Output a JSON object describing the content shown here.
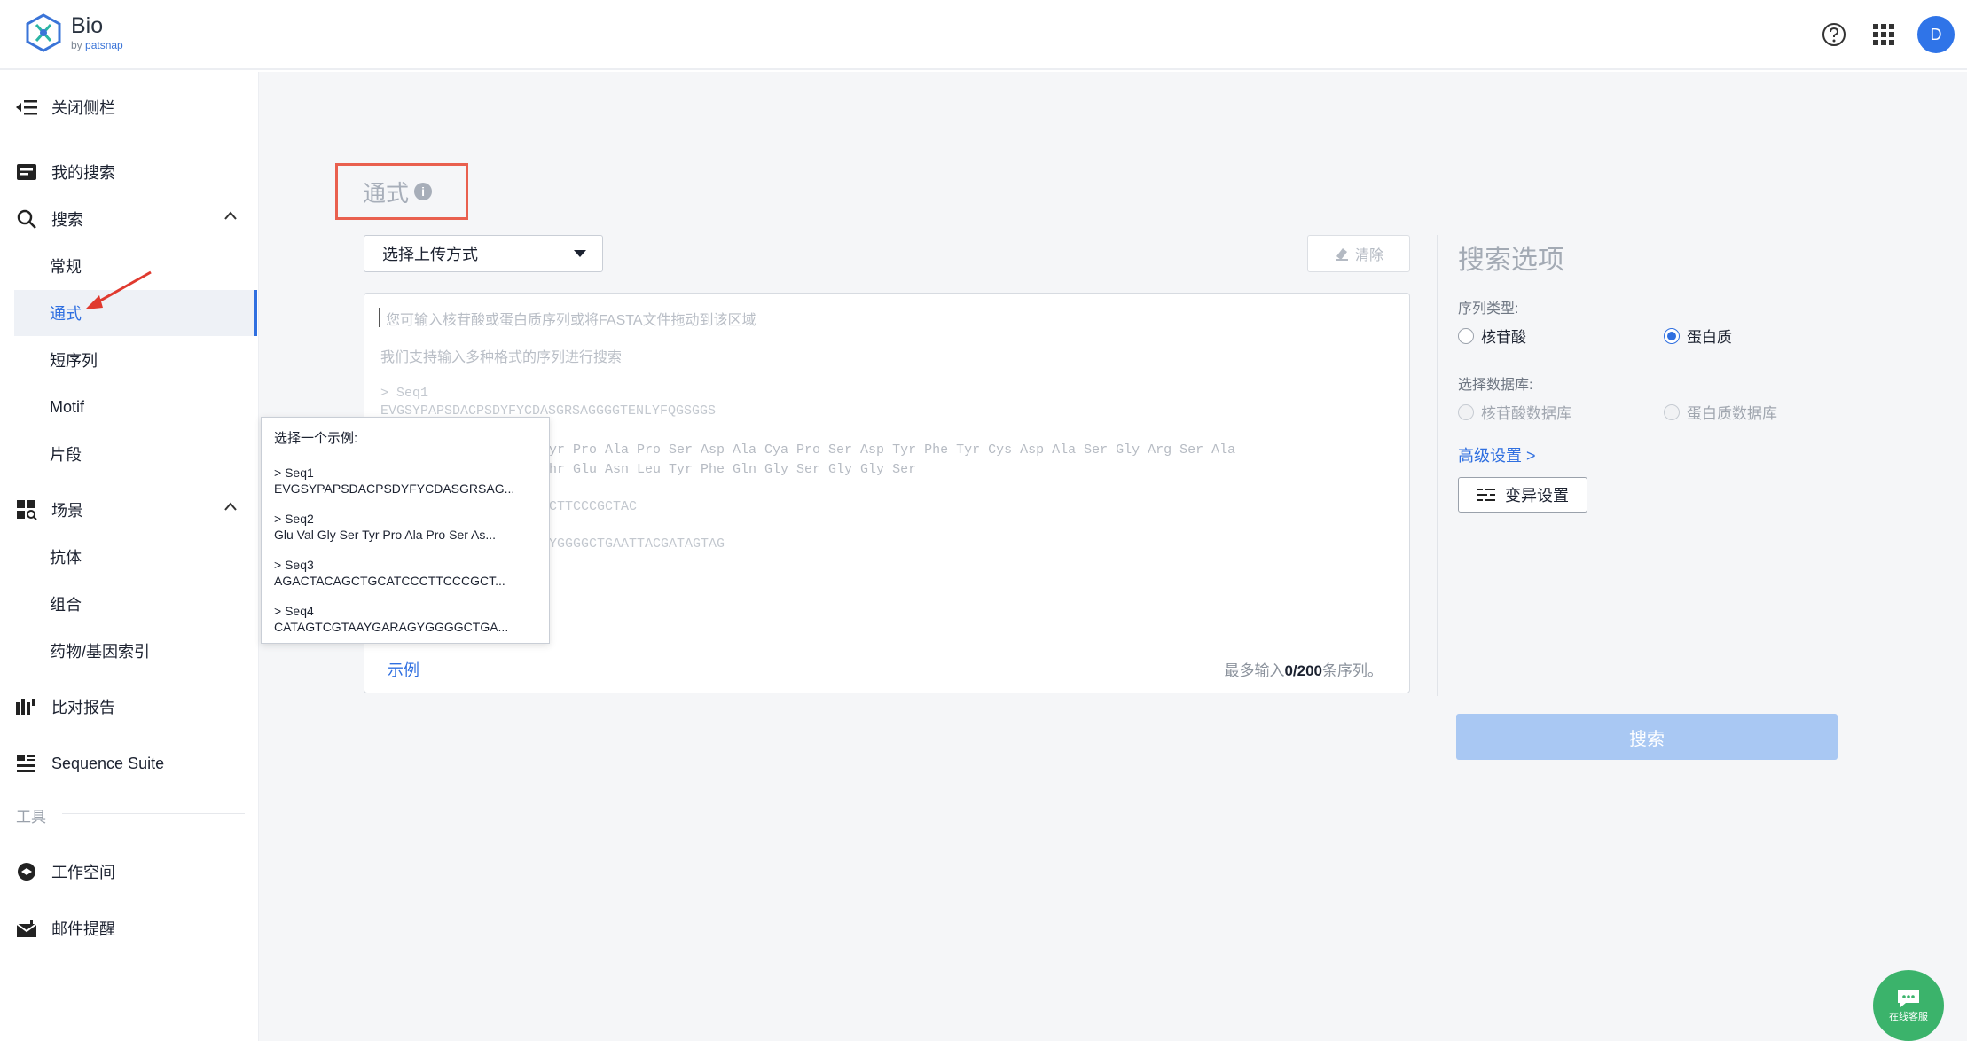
{
  "header": {
    "logo_name": "Bio",
    "logo_by": "by",
    "logo_brand": "patsnap",
    "avatar_initial": "D"
  },
  "sidebar": {
    "close_label": "关闭侧栏",
    "my_search": "我的搜索",
    "search": "搜索",
    "search_children": [
      "常规",
      "通式",
      "短序列",
      "Motif",
      "片段"
    ],
    "scenario": "场景",
    "scenario_children": [
      "抗体",
      "组合",
      "药物/基因索引"
    ],
    "compare_report": "比对报告",
    "sequence_suite": "Sequence Suite",
    "tools_section": "工具",
    "workspace": "工作空间",
    "mail_alert": "邮件提醒"
  },
  "main": {
    "title": "通式",
    "info_mark": "i",
    "upload_select": "选择上传方式",
    "clear_label": "清除",
    "placeholder_line1": "您可输入核苷酸或蛋白质序列或将FASTA文件拖动到该区域",
    "placeholder_line2": "我们支持输入多种格式的序列进行搜索",
    "sample_seq1_head": "> Seq1",
    "sample_seq1_body": "EVGSYPAPSDACPSDYFYCDASGRSAGGGGTENLYFQGSGGS",
    "sample_seq2_line1": "yr Pro Ala Pro Ser Asp Ala Cya Pro Ser Asp Tyr Phe Tyr Cys Asp Ala Ser Gly Arg Ser Ala",
    "sample_seq2_line2": "hr Glu Asn Leu Tyr Phe Gln Gly Ser Gly Gly Ser",
    "sample_seq3_body": "CTTCCCGCTAC",
    "sample_seq4_body": "YGGGGCTGAATTACGATAGTAG",
    "example_link": "示例",
    "count_prefix": "最多输入",
    "count_value": "0/200",
    "count_suffix": "条序列。"
  },
  "popup": {
    "title": "选择一个示例:",
    "examples": [
      {
        "name": "> Seq1",
        "seq": "EVGSYPAPSDACPSDYFYCDASGRSAG..."
      },
      {
        "name": "> Seq2",
        "seq": "Glu Val Gly Ser Tyr Pro Ala Pro Ser As..."
      },
      {
        "name": "> Seq3",
        "seq": "AGACTACAGCTGCATCCCTTCCCGCT..."
      },
      {
        "name": "> Seq4",
        "seq": "CATAGTCGTAAYGARAGYGGGGCTGA..."
      }
    ]
  },
  "options": {
    "title": "搜索选项",
    "seq_type_label": "序列类型:",
    "seq_type_nucleotide": "核苷酸",
    "seq_type_protein": "蛋白质",
    "db_label": "选择数据库:",
    "db_nucleotide": "核苷酸数据库",
    "db_protein": "蛋白质数据库",
    "advanced_link": "高级设置 >",
    "mutation_button": "变异设置",
    "search_button": "搜索"
  },
  "chat": {
    "label": "在线客服"
  }
}
